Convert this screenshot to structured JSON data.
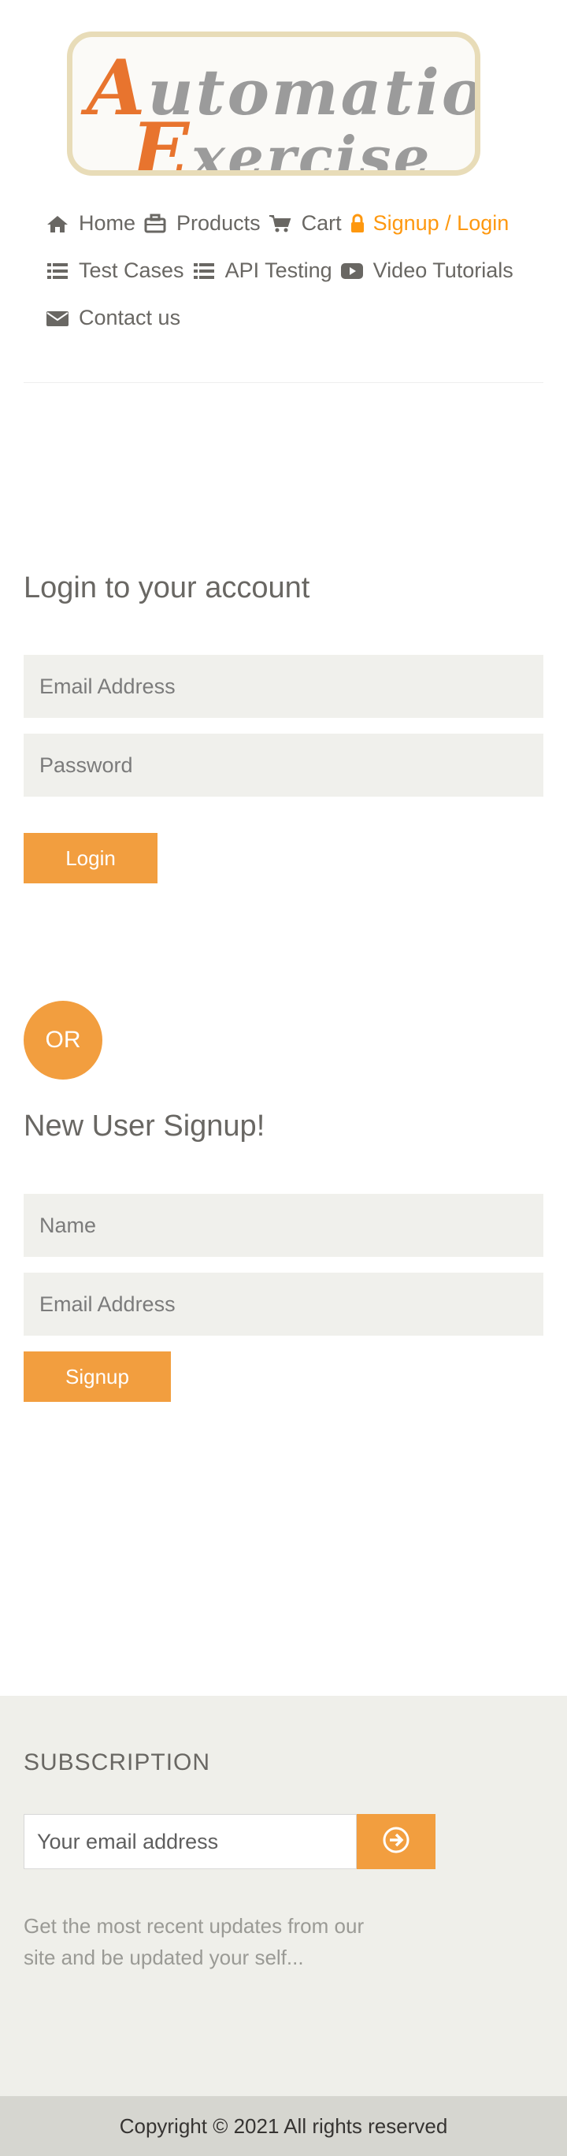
{
  "logo": {
    "line1_cap": "A",
    "line1_rest": "utomation",
    "line2_cap": "E",
    "line2_rest": "xercise"
  },
  "nav": {
    "items": [
      {
        "label": "Home",
        "icon": "home-icon"
      },
      {
        "label": "Products",
        "icon": "briefcase-icon"
      },
      {
        "label": "Cart",
        "icon": "cart-icon"
      },
      {
        "label": "Signup / Login",
        "icon": "lock-icon",
        "active": true
      },
      {
        "label": "Test Cases",
        "icon": "list-icon"
      },
      {
        "label": "API Testing",
        "icon": "list-icon"
      },
      {
        "label": "Video Tutorials",
        "icon": "youtube-play-icon"
      },
      {
        "label": "Contact us",
        "icon": "envelope-icon"
      }
    ],
    "active_color": "#fe980f"
  },
  "login": {
    "title": "Login to your account",
    "email_placeholder": "Email Address",
    "password_placeholder": "Password",
    "button": "Login"
  },
  "or_label": "OR",
  "signup": {
    "title": "New User Signup!",
    "name_placeholder": "Name",
    "email_placeholder": "Email Address",
    "button": "Signup"
  },
  "subscription": {
    "title": "SUBSCRIPTION",
    "input_placeholder": "Your email address",
    "button_icon": "arrow-circle-right-icon",
    "description": "Get the most recent updates from our site and be updated your self..."
  },
  "footer": {
    "copyright": "Copyright © 2021 All rights reserved"
  },
  "colors": {
    "accent": "#f29e3f",
    "field_bg": "#f0f0ec",
    "footer_bg": "#efefea"
  }
}
